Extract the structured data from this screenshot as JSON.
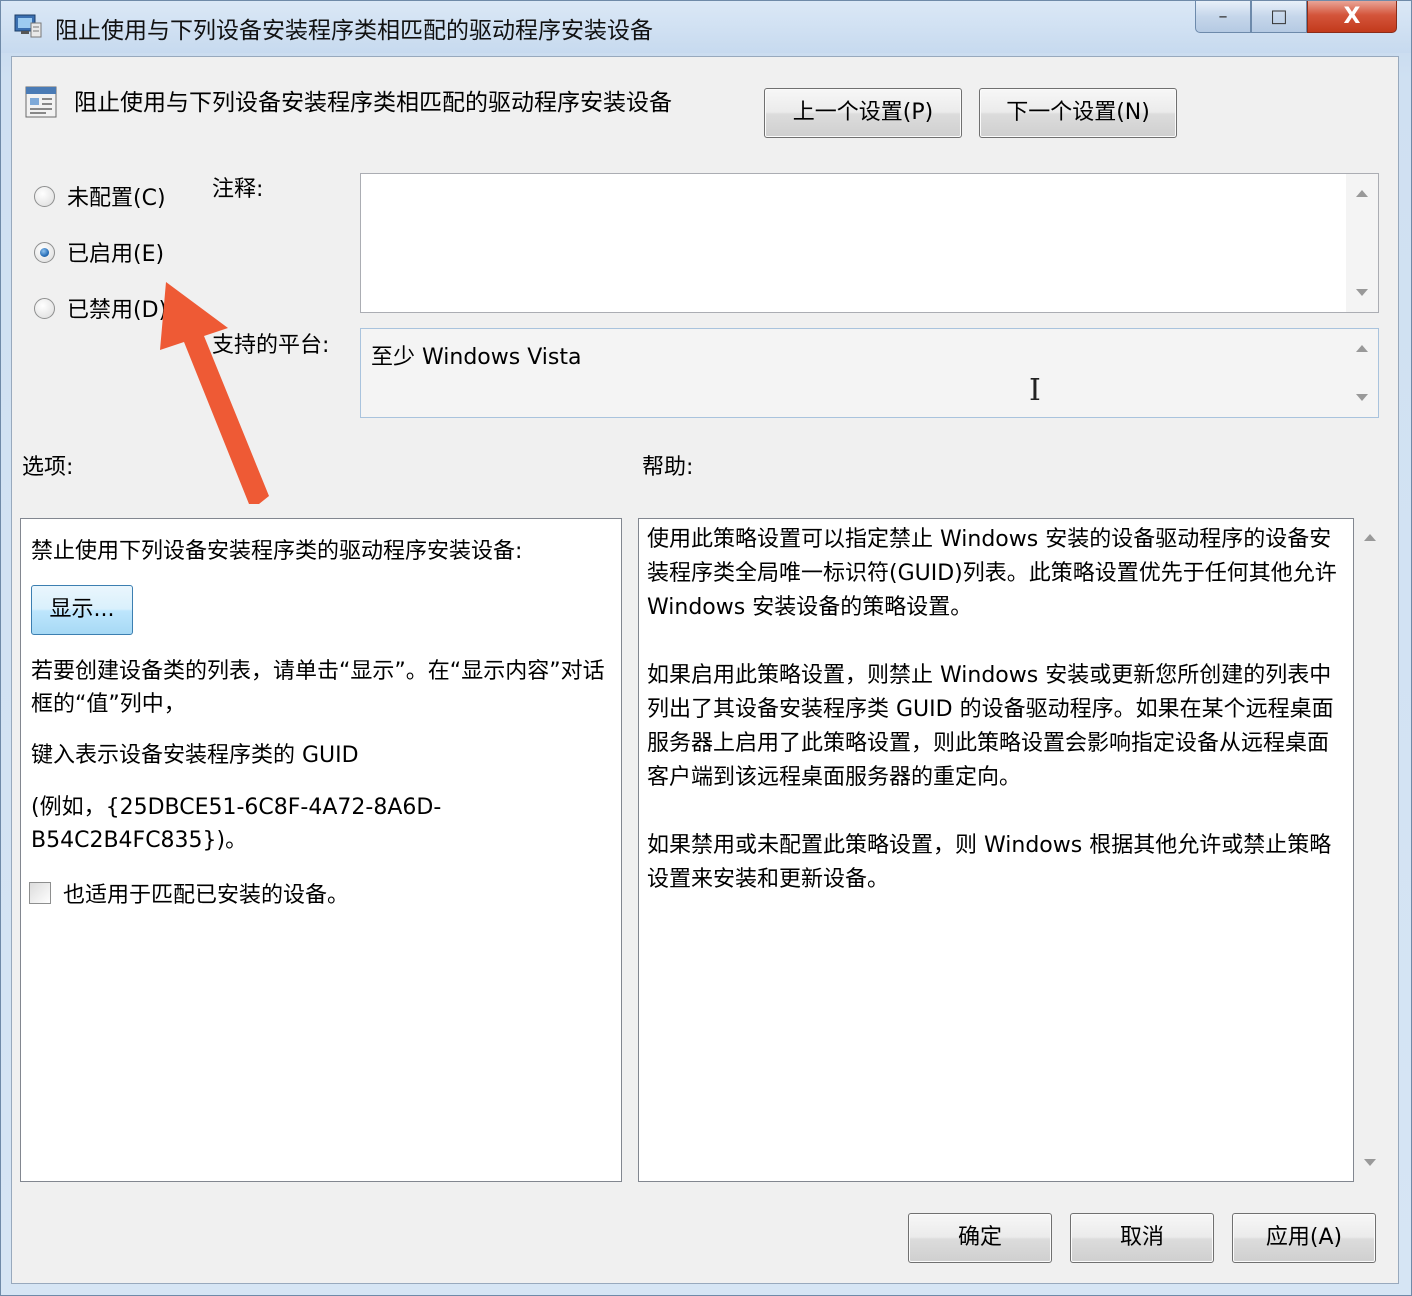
{
  "window": {
    "title": "阻止使用与下列设备安装程序类相匹配的驱动程序安装设备",
    "minimize": "–",
    "maximize": "□",
    "close": "X"
  },
  "header": {
    "policy_title": "阻止使用与下列设备安装程序类相匹配的驱动程序安装设备",
    "prev_label": "上一个设置(P)",
    "next_label": "下一个设置(N)"
  },
  "state": {
    "not_configured": "未配置(C)",
    "enabled": "已启用(E)",
    "disabled": "已禁用(D)",
    "selected": "enabled"
  },
  "comment": {
    "label": "注释:",
    "value": ""
  },
  "platform": {
    "label": "支持的平台:",
    "value": "至少 Windows Vista"
  },
  "options": {
    "label": "选项:",
    "line1": "禁止使用下列设备安装程序类的驱动程序安装设备:",
    "show_button": "显示...",
    "line2": "若要创建设备类的列表，请单击“显示”。在“显示内容”对话框的“值”列中，",
    "line3": "键入表示设备安装程序类的 GUID",
    "line4": "(例如，{25DBCE51-6C8F-4A72-8A6D-B54C2B4FC835})。",
    "checkbox_label": "也适用于匹配已安装的设备。"
  },
  "help": {
    "label": "帮助:",
    "p1": "使用此策略设置可以指定禁止 Windows 安装的设备驱动程序的设备安装程序类全局唯一标识符(GUID)列表。此策略设置优先于任何其他允许 Windows 安装设备的策略设置。",
    "p2": "如果启用此策略设置，则禁止 Windows 安装或更新您所创建的列表中列出了其设备安装程序类 GUID 的设备驱动程序。如果在某个远程桌面服务器上启用了此策略设置，则此策略设置会影响指定设备从远程桌面客户端到该远程桌面服务器的重定向。",
    "p3": "如果禁用或未配置此策略设置，则 Windows 根据其他允许或禁止策略设置来安装和更新设备。"
  },
  "footer": {
    "ok": "确定",
    "cancel": "取消",
    "apply": "应用(A)"
  },
  "colors": {
    "annotation_arrow": "#ee5a35",
    "accent": "#2a6fb7"
  }
}
